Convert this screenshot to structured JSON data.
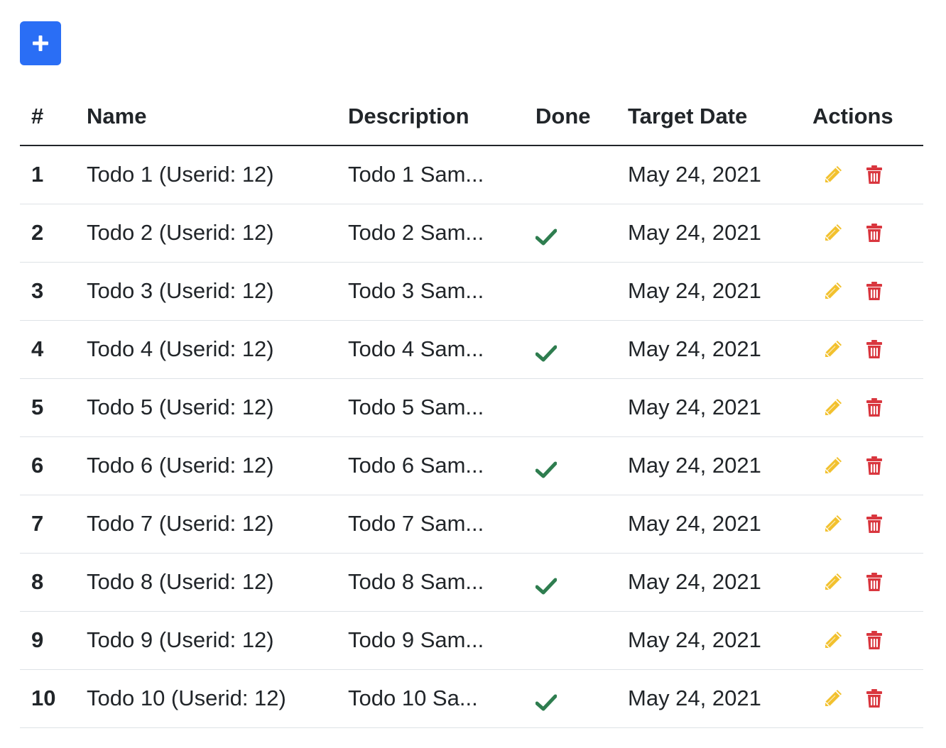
{
  "toolbar": {
    "add_icon": "plus-icon",
    "accent": "#2a6ef5"
  },
  "table": {
    "headers": [
      "#",
      "Name",
      "Description",
      "Done",
      "Target Date",
      "Actions"
    ],
    "rows": [
      {
        "index": "1",
        "name": "Todo 1 (Userid: 12)",
        "description": "Todo 1 Sam...",
        "done": false,
        "target_date": "May 24, 2021"
      },
      {
        "index": "2",
        "name": "Todo 2 (Userid: 12)",
        "description": "Todo 2 Sam...",
        "done": true,
        "target_date": "May 24, 2021"
      },
      {
        "index": "3",
        "name": "Todo 3 (Userid: 12)",
        "description": "Todo 3 Sam...",
        "done": false,
        "target_date": "May 24, 2021"
      },
      {
        "index": "4",
        "name": "Todo 4 (Userid: 12)",
        "description": "Todo 4 Sam...",
        "done": true,
        "target_date": "May 24, 2021"
      },
      {
        "index": "5",
        "name": "Todo 5 (Userid: 12)",
        "description": "Todo 5 Sam...",
        "done": false,
        "target_date": "May 24, 2021"
      },
      {
        "index": "6",
        "name": "Todo 6 (Userid: 12)",
        "description": "Todo 6 Sam...",
        "done": true,
        "target_date": "May 24, 2021"
      },
      {
        "index": "7",
        "name": "Todo 7 (Userid: 12)",
        "description": "Todo 7 Sam...",
        "done": false,
        "target_date": "May 24, 2021"
      },
      {
        "index": "8",
        "name": "Todo 8 (Userid: 12)",
        "description": "Todo 8 Sam...",
        "done": true,
        "target_date": "May 24, 2021"
      },
      {
        "index": "9",
        "name": "Todo 9 (Userid: 12)",
        "description": "Todo 9 Sam...",
        "done": false,
        "target_date": "May 24, 2021"
      },
      {
        "index": "10",
        "name": "Todo 10 (Userid: 12)",
        "description": "Todo 10 Sa...",
        "done": true,
        "target_date": "May 24, 2021"
      }
    ],
    "icons": {
      "done": "check-icon",
      "edit": "pencil-icon",
      "delete": "trash-icon"
    },
    "colors": {
      "done": "#2e7d4f",
      "edit": "#f2c12e",
      "delete": "#d9363e"
    }
  }
}
